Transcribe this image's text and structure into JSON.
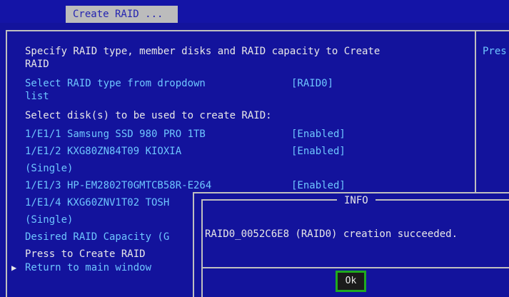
{
  "tab_title": "Create RAID ...",
  "help_fragment": "Pres",
  "description": [
    "Specify RAID type, member disks and RAID capacity to Create",
    "RAID"
  ],
  "raid_type": {
    "label": [
      "Select RAID type from dropdown",
      "list"
    ],
    "value": "[RAID0]"
  },
  "disk_header": "Select disk(s) to be used to create RAID:",
  "disks": [
    {
      "label": "1/E1/1 Samsung SSD 980 PRO 1TB",
      "value": "[Enabled]"
    },
    {
      "label": "1/E1/2 KXG80ZN84T09 KIOXIA",
      "value": "[Enabled]",
      "extra": "(Single)"
    },
    {
      "label": "1/E1/3 HP-EM2802T0GMTCB58R-E264",
      "value": "[Enabled]"
    },
    {
      "label": "1/E1/4 KXG60ZNV1T02 TOSH",
      "extra": "(Single)"
    }
  ],
  "capacity_label": "Desired RAID Capacity (G",
  "press_create": "Press to Create RAID",
  "return_label": "Return to main window",
  "arrow_glyph": "▶",
  "dialog": {
    "title": "INFO",
    "message": "RAID0_0052C6E8 (RAID0) creation succeeded.",
    "ok_label": "Ok"
  }
}
